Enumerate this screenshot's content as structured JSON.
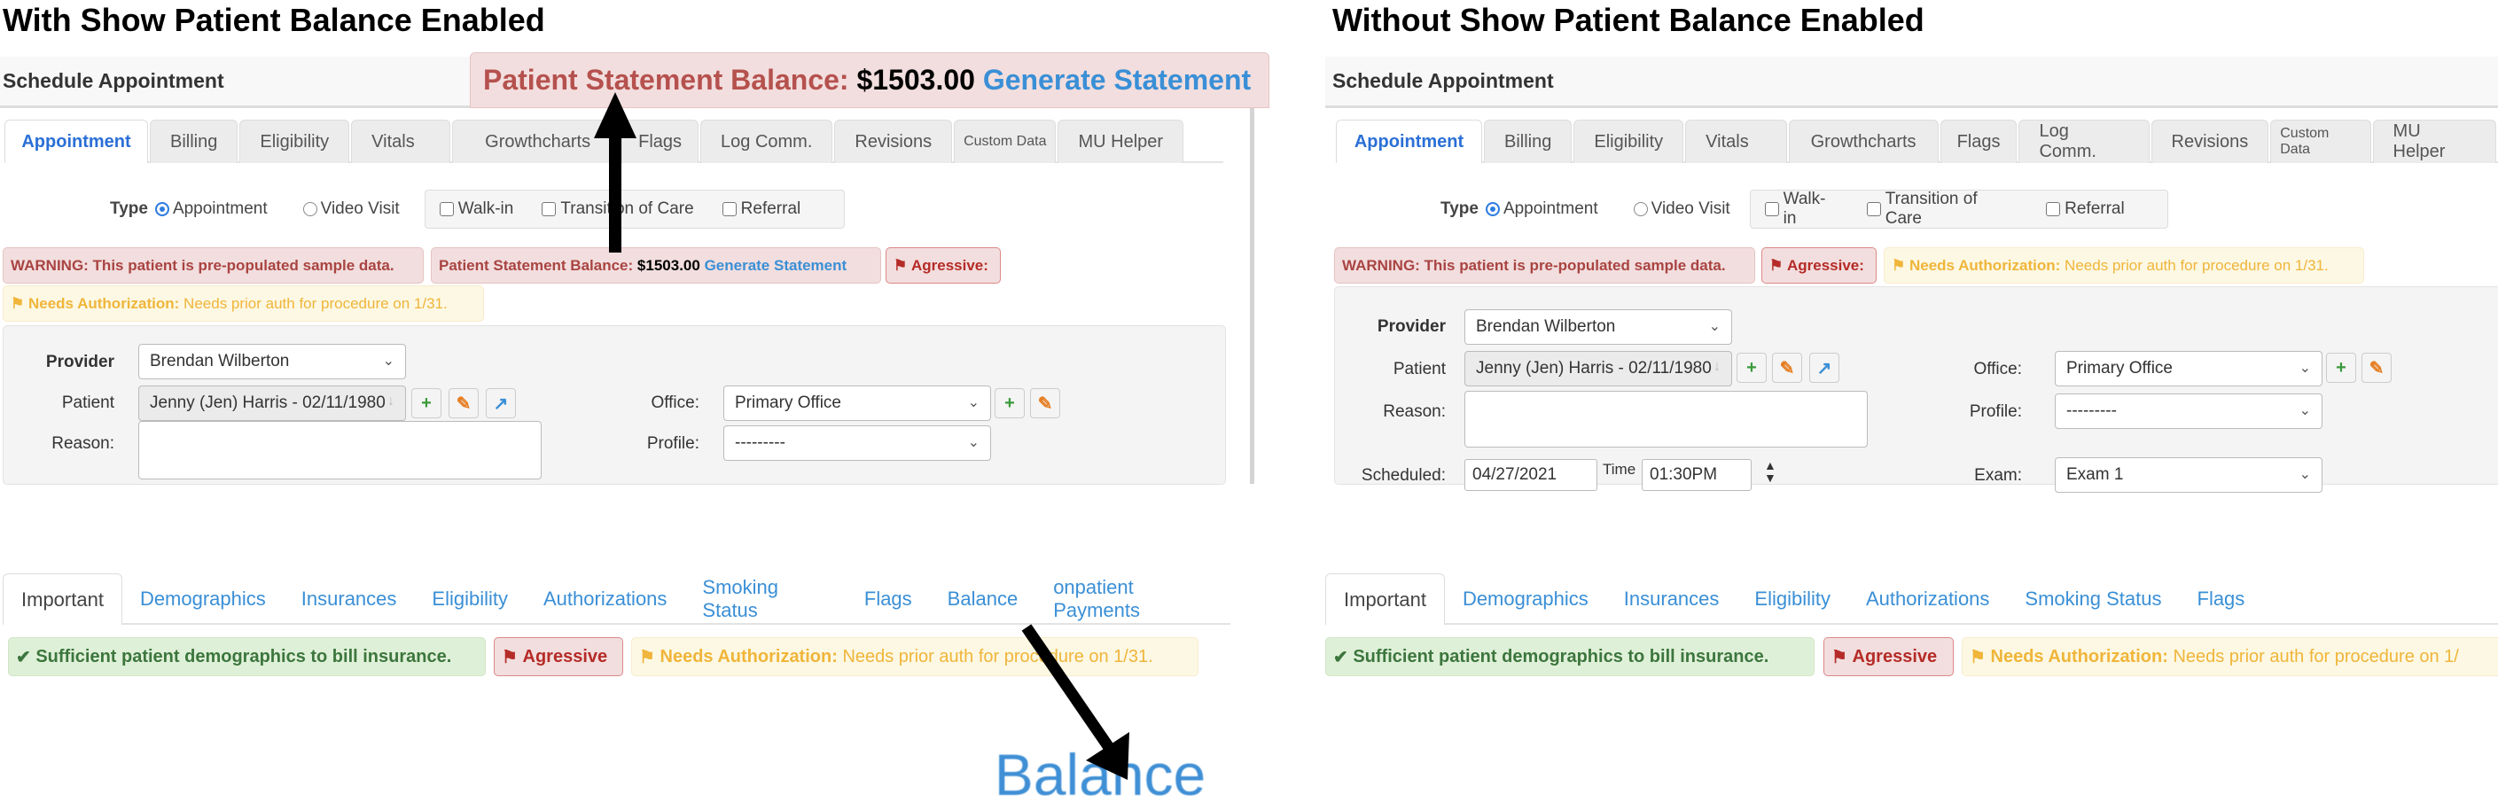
{
  "left": {
    "title": "With Show Patient Balance Enabled",
    "header": "Schedule Appointment",
    "callout": {
      "label": "Patient Statement Balance:",
      "amount": "$1503.00",
      "link": "Generate Statement"
    },
    "tabs": [
      "Appointment",
      "Billing",
      "Eligibility",
      "Vitals",
      "Growthcharts",
      "Flags",
      "Log Comm.",
      "Revisions",
      "Custom Data",
      "MU Helper"
    ],
    "type": {
      "label": "Type",
      "radio_appointment": "Appointment",
      "radio_video": "Video Visit",
      "check_walkin": "Walk-in",
      "check_transition": "Transition of Care",
      "check_referral": "Referral"
    },
    "alerts": {
      "warning": "WARNING: This patient is pre-populated sample data.",
      "balance_label": "Patient Statement Balance:",
      "balance_amount": "$1503.00",
      "balance_link": "Generate Statement",
      "agressive": "Agressive:",
      "auth_title": "Needs Authorization:",
      "auth_text": "Needs prior auth for procedure on 1/31."
    },
    "form": {
      "provider_label": "Provider",
      "provider_value": "Brendan Wilberton",
      "patient_label": "Patient",
      "patient_value": "Jenny (Jen) Harris - 02/11/1980",
      "reason_label": "Reason:",
      "office_label": "Office:",
      "office_value": "Primary Office",
      "profile_label": "Profile:",
      "profile_value": "---------"
    },
    "bottom_tabs": [
      "Important",
      "Demographics",
      "Insurances",
      "Eligibility",
      "Authorizations",
      "Smoking Status",
      "Flags",
      "Balance",
      "onpatient Payments"
    ],
    "bottom_badges": {
      "sufficient": "Sufficient patient demographics to bill insurance.",
      "agressive": "Agressive",
      "auth_title": "Needs Authorization:",
      "auth_text": "Needs prior auth for procedure on 1/31."
    },
    "inset_label": "Balance"
  },
  "right": {
    "title": "Without Show Patient Balance Enabled",
    "header": "Schedule Appointment",
    "tabs": [
      "Appointment",
      "Billing",
      "Eligibility",
      "Vitals",
      "Growthcharts",
      "Flags",
      "Log Comm.",
      "Revisions",
      "Custom Data",
      "MU Helper"
    ],
    "type": {
      "label": "Type",
      "radio_appointment": "Appointment",
      "radio_video": "Video Visit",
      "check_walkin": "Walk-in",
      "check_transition": "Transition of Care",
      "check_referral": "Referral"
    },
    "alerts": {
      "warning": "WARNING: This patient is pre-populated sample data.",
      "agressive": "Agressive:",
      "auth_title": "Needs Authorization:",
      "auth_text": "Needs prior auth for procedure on 1/31."
    },
    "form": {
      "provider_label": "Provider",
      "provider_value": "Brendan Wilberton",
      "patient_label": "Patient",
      "patient_value": "Jenny (Jen) Harris - 02/11/1980",
      "reason_label": "Reason:",
      "scheduled_label": "Scheduled:",
      "scheduled_value": "04/27/2021",
      "time_label": "Time",
      "time_value": "01:30PM",
      "office_label": "Office:",
      "office_value": "Primary Office",
      "profile_label": "Profile:",
      "profile_value": "---------",
      "exam_label": "Exam:",
      "exam_value": "Exam 1"
    },
    "bottom_tabs": [
      "Important",
      "Demographics",
      "Insurances",
      "Eligibility",
      "Authorizations",
      "Smoking Status",
      "Flags"
    ],
    "bottom_badges": {
      "sufficient": "Sufficient patient demographics to bill insurance.",
      "agressive": "Agressive",
      "auth_title": "Needs Authorization:",
      "auth_text": "Needs prior auth for procedure on 1/"
    }
  },
  "colors": {
    "danger_text": "#a94442",
    "warning_text": "#f0b53a",
    "success_text": "#3c763d",
    "link": "#3a8fd6",
    "active_tab": "#2a6fd6"
  }
}
